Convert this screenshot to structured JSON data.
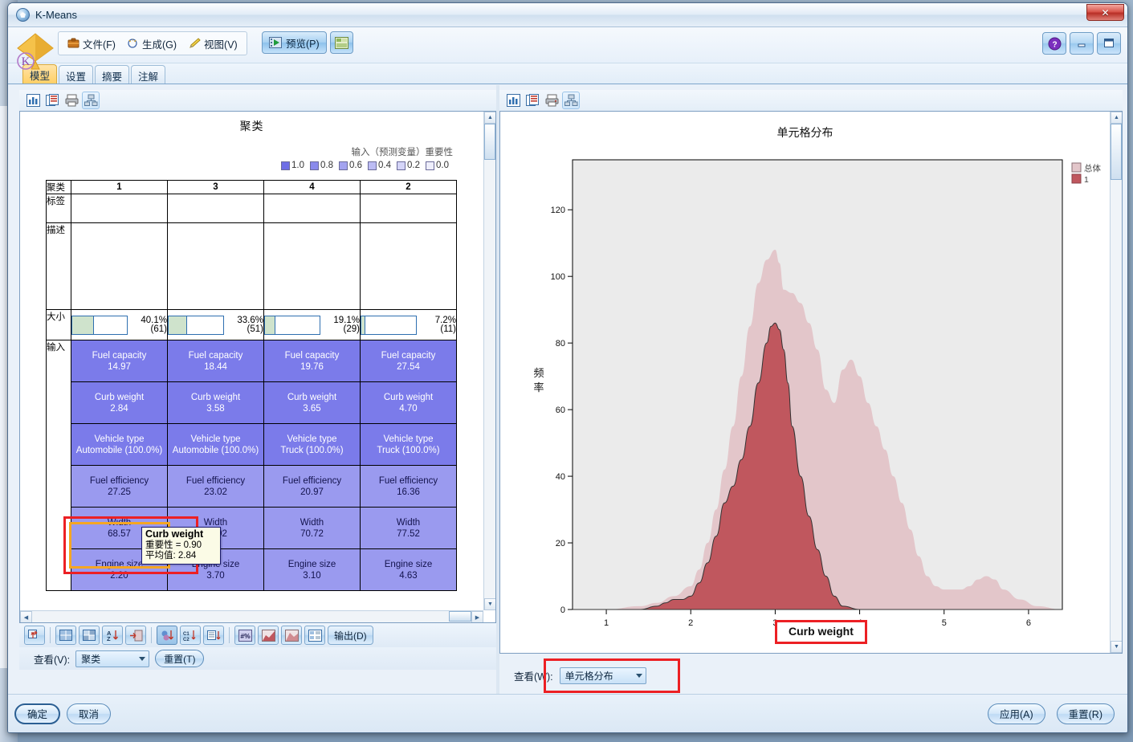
{
  "window": {
    "title": "K-Means",
    "icon": "kmeans-diamond-icon",
    "close_label": "✕"
  },
  "toolbar": {
    "menus": [
      {
        "label": "文件(F)",
        "icon": "folder-icon"
      },
      {
        "label": "生成(G)",
        "icon": "magic-wand-icon"
      },
      {
        "label": "视图(V)",
        "icon": "paintbrush-icon"
      }
    ],
    "preview_label": "预览(P)",
    "export_label": "",
    "help_label": "?",
    "minimize_label": "",
    "maximize_label": ""
  },
  "tabs": [
    {
      "label": "模型",
      "active": true
    },
    {
      "label": "设置",
      "active": false
    },
    {
      "label": "摘要",
      "active": false
    },
    {
      "label": "注解",
      "active": false
    }
  ],
  "left_pane": {
    "title": "聚类",
    "importance_legend": {
      "title": "输入（预测变量）重要性",
      "values": [
        "1.0",
        "0.8",
        "0.6",
        "0.4",
        "0.2",
        "0.0"
      ],
      "colors": [
        "#6e6ee6",
        "#8a8aec",
        "#a3a3f0",
        "#bcbcf4",
        "#d5d5f8",
        "#eeeefb"
      ]
    },
    "table": {
      "row_labels": {
        "cluster": "聚类",
        "label": "标签",
        "description": "描述",
        "size": "大小",
        "inputs": "输入"
      },
      "columns": [
        "1",
        "3",
        "4",
        "2"
      ],
      "labels": [
        "",
        "",
        "",
        ""
      ],
      "descriptions": [
        "",
        "",
        "",
        ""
      ],
      "sizes": [
        {
          "pct": "40.1%",
          "count": "(61)",
          "fill": 40.1
        },
        {
          "pct": "33.6%",
          "count": "(51)",
          "fill": 33.6
        },
        {
          "pct": "19.1%",
          "count": "(29)",
          "fill": 19.1
        },
        {
          "pct": "7.2%",
          "count": "(11)",
          "fill": 7.2
        }
      ],
      "input_rows": [
        {
          "name": "Fuel capacity",
          "importance_class": "imp-90",
          "values": [
            "14.97",
            "18.44",
            "19.76",
            "27.54"
          ]
        },
        {
          "name": "Curb weight",
          "importance_class": "imp-90",
          "values": [
            "2.84",
            "3.58",
            "3.65",
            "4.70"
          ]
        },
        {
          "name": "Vehicle type",
          "importance_class": "imp-90",
          "values": [
            "Automobile (100.0%)",
            "Automobile (100.0%)",
            "Truck (100.0%)",
            "Truck (100.0%)"
          ]
        },
        {
          "name": "Fuel efficiency",
          "importance_class": "imp-60",
          "values": [
            "27.25",
            "23.02",
            "20.97",
            "16.36"
          ]
        },
        {
          "name": "Width",
          "importance_class": "imp-60",
          "values": [
            "68.57",
            "72.92",
            "70.72",
            "77.52"
          ]
        },
        {
          "name": "Engine size",
          "importance_class": "imp-60",
          "values": [
            "2.20",
            "3.70",
            "3.10",
            "4.63"
          ]
        }
      ]
    },
    "tooltip": {
      "title": "Curb weight",
      "importance": "重要性 = 0.90",
      "mean": "平均值: 2.84"
    },
    "view_label": "查看(V):",
    "view_value": "聚类",
    "reset_label": "重置(T)",
    "output_label": "输出(D)"
  },
  "right_pane": {
    "view_label": "查看(W):",
    "view_value": "单元格分布",
    "xaxis_highlight": "Curb weight"
  },
  "footer": {
    "ok_label": "确定",
    "cancel_label": "取消",
    "apply_label": "应用(A)",
    "reset_label": "重置(R)"
  },
  "chart_data": {
    "type": "area",
    "title": "单元格分布",
    "xlabel": "Curb weight",
    "ylabel": "频率",
    "xlim": [
      0.6,
      6.4
    ],
    "ylim": [
      0,
      135
    ],
    "xticks": [
      1,
      2,
      3,
      4,
      5,
      6
    ],
    "yticks": [
      0,
      20,
      40,
      60,
      80,
      100,
      120
    ],
    "grid": false,
    "legend_position": "top-right",
    "plot_background": "#ebebeb",
    "series": [
      {
        "name": "总体",
        "color": "#e3c6ca",
        "x": [
          0.6,
          1.0,
          1.4,
          1.6,
          1.8,
          2.0,
          2.1,
          2.2,
          2.3,
          2.4,
          2.5,
          2.6,
          2.7,
          2.8,
          2.9,
          3.0,
          3.05,
          3.1,
          3.2,
          3.3,
          3.4,
          3.5,
          3.6,
          3.7,
          3.8,
          3.9,
          4.0,
          4.1,
          4.2,
          4.3,
          4.4,
          4.5,
          4.6,
          4.7,
          4.8,
          4.9,
          5.0,
          5.1,
          5.2,
          5.3,
          5.4,
          5.5,
          5.6,
          5.7,
          5.9,
          6.1,
          6.4
        ],
        "y": [
          0,
          0,
          1,
          2,
          4,
          7,
          12,
          20,
          30,
          42,
          55,
          70,
          85,
          98,
          105,
          108,
          104,
          96,
          95,
          92,
          86,
          78,
          66,
          62,
          72,
          75,
          70,
          62,
          55,
          48,
          40,
          32,
          24,
          16,
          10,
          7,
          6,
          6,
          6,
          7,
          9,
          10,
          9,
          6,
          3,
          1,
          0
        ]
      },
      {
        "name": "1",
        "color": "#c0575e",
        "x": [
          0.6,
          1.0,
          1.4,
          1.6,
          1.7,
          1.8,
          1.9,
          2.0,
          2.1,
          2.2,
          2.3,
          2.4,
          2.5,
          2.6,
          2.7,
          2.8,
          2.9,
          2.95,
          3.0,
          3.05,
          3.1,
          3.15,
          3.2,
          3.3,
          3.4,
          3.5,
          3.6,
          3.7,
          3.8,
          4.0,
          6.4
        ],
        "y": [
          0,
          0,
          0,
          1,
          2,
          3,
          3,
          4,
          8,
          14,
          22,
          32,
          37,
          45,
          55,
          68,
          80,
          85,
          86,
          84,
          78,
          68,
          55,
          40,
          28,
          18,
          10,
          4,
          1,
          0,
          0
        ]
      }
    ]
  }
}
